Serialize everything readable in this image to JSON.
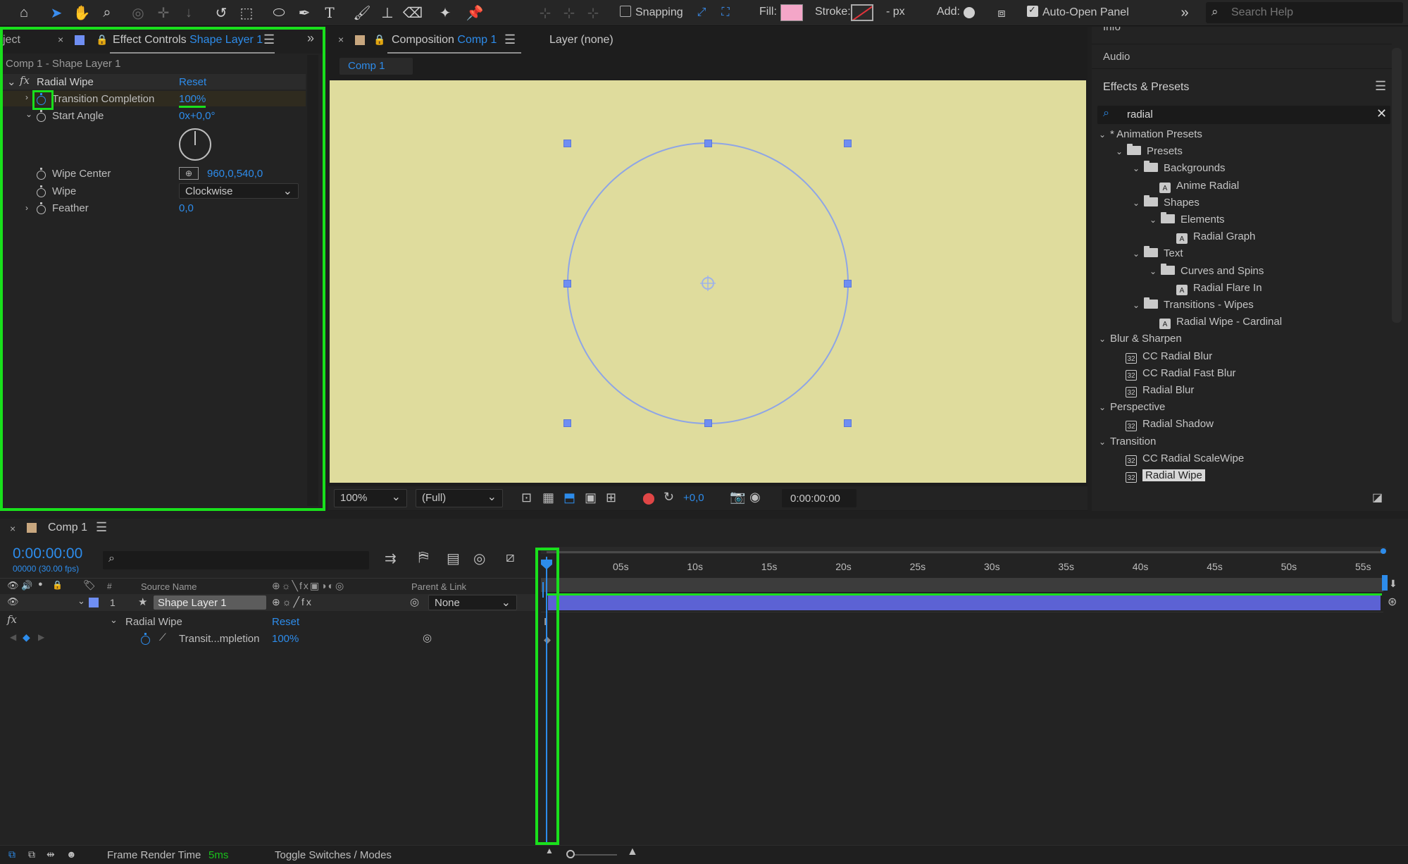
{
  "toolbar": {
    "snapping_label": "Snapping",
    "fill_label": "Fill:",
    "stroke_label": "Stroke:",
    "stroke_units": "- px",
    "add_label": "Add:",
    "auto_open_label": "Auto-Open Panel",
    "search_placeholder": "Search Help",
    "fill_color": "#f4a6c8"
  },
  "effect_controls": {
    "tab_left_partial": "ject",
    "tab_title": "Effect Controls",
    "tab_layer": "Shape Layer 1",
    "breadcrumb": "Comp 1 - Shape Layer 1",
    "effect_name": "Radial Wipe",
    "reset_label": "Reset",
    "props": [
      {
        "name": "Transition Completion",
        "value": "100%"
      },
      {
        "name": "Start Angle",
        "value": "0x+0,0°"
      },
      {
        "name": "Wipe Center",
        "value": "960,0,540,0"
      },
      {
        "name": "Wipe",
        "value": "Clockwise"
      },
      {
        "name": "Feather",
        "value": "0,0"
      }
    ]
  },
  "composition": {
    "tab_title": "Composition",
    "tab_comp": "Comp 1",
    "layer_tab": "Layer (none)",
    "subtab": "Comp 1",
    "bg_color": "#dfdc9d",
    "zoom": "100%",
    "resolution": "(Full)",
    "exposure": "+0,0",
    "timecode": "0:00:00:00"
  },
  "right_panel": {
    "info_label": "Info",
    "audio_label": "Audio",
    "effects_title": "Effects & Presets",
    "search_value": "radial",
    "tree": [
      {
        "label": "* Animation Presets",
        "type": "group"
      },
      {
        "label": "Presets",
        "type": "folder"
      },
      {
        "label": "Backgrounds",
        "type": "folder"
      },
      {
        "label": "Anime Radial",
        "type": "preset"
      },
      {
        "label": "Shapes",
        "type": "folder"
      },
      {
        "label": "Elements",
        "type": "folder"
      },
      {
        "label": "Radial Graph",
        "type": "preset"
      },
      {
        "label": "Text",
        "type": "folder"
      },
      {
        "label": "Curves and Spins",
        "type": "folder"
      },
      {
        "label": "Radial Flare In",
        "type": "preset"
      },
      {
        "label": "Transitions - Wipes",
        "type": "folder"
      },
      {
        "label": "Radial Wipe - Cardinal",
        "type": "preset"
      },
      {
        "label": "Blur & Sharpen",
        "type": "group"
      },
      {
        "label": "CC Radial Blur",
        "type": "effect"
      },
      {
        "label": "CC Radial Fast Blur",
        "type": "effect"
      },
      {
        "label": "Radial Blur",
        "type": "effect"
      },
      {
        "label": "Perspective",
        "type": "group"
      },
      {
        "label": "Radial Shadow",
        "type": "effect"
      },
      {
        "label": "Transition",
        "type": "group"
      },
      {
        "label": "CC Radial ScaleWipe",
        "type": "effect"
      },
      {
        "label": "Radial Wipe",
        "type": "effect"
      }
    ]
  },
  "timeline": {
    "tab": "Comp 1",
    "timecode": "0:00:00:00",
    "frame_info": "00000 (30.00 fps)",
    "col_source": "Source Name",
    "col_hash": "#",
    "col_parent": "Parent & Link",
    "layer_num": "1",
    "layer_name": "Shape Layer 1",
    "parent_value": "None",
    "effect_name": "Radial Wipe",
    "reset_label": "Reset",
    "prop_name": "Transit...mpletion",
    "prop_value": "100%",
    "ruler": [
      "05s",
      "10s",
      "15s",
      "20s",
      "25s",
      "30s",
      "35s",
      "40s",
      "45s",
      "50s",
      "55s"
    ],
    "status_label": "Frame Render Time",
    "status_value": "5ms",
    "toggle_label": "Toggle Switches / Modes"
  }
}
